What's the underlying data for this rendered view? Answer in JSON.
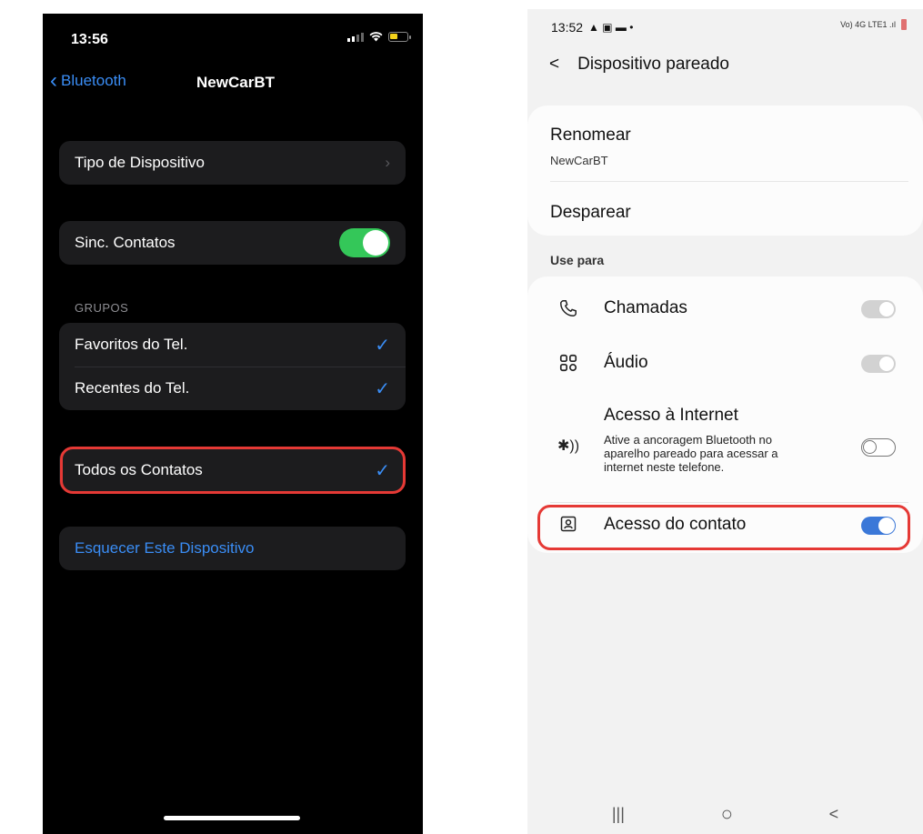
{
  "ios": {
    "status": {
      "time": "13:56"
    },
    "nav": {
      "back_label": "Bluetooth",
      "title": "NewCarBT"
    },
    "device_type": {
      "label": "Tipo de Dispositivo"
    },
    "sync_contacts": {
      "label": "Sinc. Contatos",
      "enabled": true
    },
    "groups": {
      "header": "GRUPOS",
      "items": [
        {
          "label": "Favoritos do Tel.",
          "checked": true
        },
        {
          "label": "Recentes do Tel.",
          "checked": true
        }
      ]
    },
    "all_contacts": {
      "label": "Todos os Contatos",
      "checked": true,
      "highlighted": true
    },
    "forget": {
      "label": "Esquecer Este Dispositivo"
    },
    "colors": {
      "accent": "#3a8df5",
      "toggle_on": "#34c759",
      "highlight": "#e53935"
    }
  },
  "android": {
    "status": {
      "time": "13:52",
      "right": "Vo) 4G LTE1 .ıl"
    },
    "header": {
      "back": "<",
      "title": "Dispositivo pareado"
    },
    "rename": {
      "title": "Renomear",
      "value": "NewCarBT"
    },
    "unpair": {
      "label": "Desparear"
    },
    "use_for": {
      "title": "Use para",
      "items": [
        {
          "icon": "phone-icon",
          "label": "Chamadas",
          "state": "on-disabled"
        },
        {
          "icon": "audio-icon",
          "label": "Áudio",
          "state": "on-disabled"
        },
        {
          "icon": "bluetooth-tether-icon",
          "label": "Acesso à Internet",
          "description_lines": [
            "Ative a ancoragem Bluetooth no",
            "aparelho pareado para acessar a",
            "internet neste telefone."
          ],
          "state": "off"
        },
        {
          "icon": "contact-icon",
          "label": "Acesso do contato",
          "state": "on",
          "highlighted": true
        }
      ]
    },
    "navbar": {
      "recent": "|||",
      "home": "○",
      "back": "<"
    },
    "colors": {
      "toggle_on": "#3b78d8",
      "highlight": "#e53935"
    }
  }
}
